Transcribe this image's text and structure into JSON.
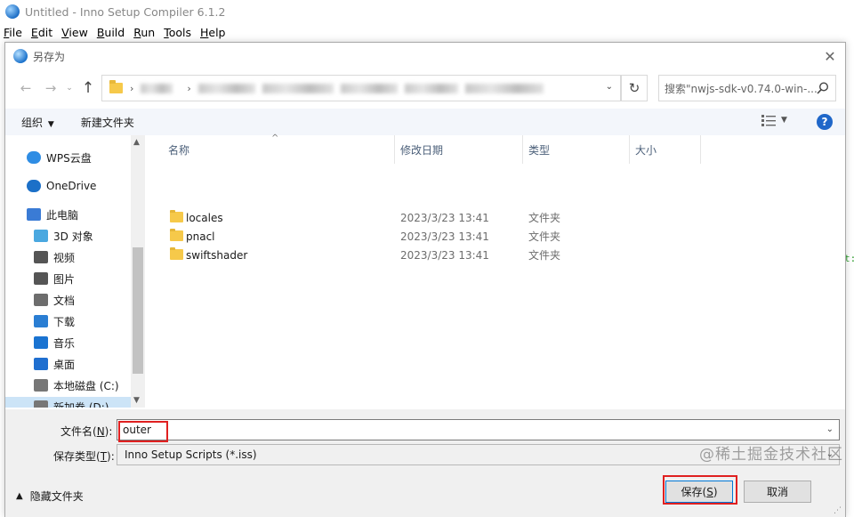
{
  "app": {
    "title": "Untitled - Inno Setup Compiler 6.1.2",
    "menu": [
      {
        "label": "File",
        "ul": "F",
        "rest": "ile"
      },
      {
        "label": "Edit",
        "ul": "E",
        "rest": "dit"
      },
      {
        "label": "View",
        "ul": "V",
        "rest": "iew"
      },
      {
        "label": "Build",
        "ul": "B",
        "rest": "uild"
      },
      {
        "label": "Run",
        "ul": "R",
        "rest": "un"
      },
      {
        "label": "Tools",
        "ul": "T",
        "rest": "ools"
      },
      {
        "label": "Help",
        "ul": "H",
        "rest": "elp"
      }
    ],
    "editor_glyph": "t:"
  },
  "dialog": {
    "title": "另存为",
    "close_glyph": "✕",
    "address": {
      "sep": "›",
      "chevron": "⌄",
      "refresh_glyph": "↻"
    },
    "search": {
      "placeholder": "搜索\"nwjs-sdk-v0.74.0-win-..."
    },
    "toolbar": {
      "organize": "组织",
      "new_folder": "新建文件夹",
      "help": "?"
    },
    "nav": {
      "items": [
        {
          "label": "WPS云盘",
          "icon": "cloud-icon",
          "color": "#2f8de4"
        },
        {
          "label": "OneDrive",
          "icon": "onedrive-icon",
          "color": "#1c70c8"
        },
        {
          "label": "此电脑",
          "icon": "computer-icon",
          "color": "#3a7bd5"
        },
        {
          "label": "3D 对象",
          "icon": "cube-3d-icon",
          "color": "#4aa8e0"
        },
        {
          "label": "视频",
          "icon": "video-icon",
          "color": "#555555"
        },
        {
          "label": "图片",
          "icon": "picture-icon",
          "color": "#555555"
        },
        {
          "label": "文档",
          "icon": "document-icon",
          "color": "#6d6d6d"
        },
        {
          "label": "下载",
          "icon": "download-icon",
          "color": "#2a7ed3"
        },
        {
          "label": "音乐",
          "icon": "music-icon",
          "color": "#1a73d1"
        },
        {
          "label": "桌面",
          "icon": "desktop-icon",
          "color": "#1f6fd0"
        },
        {
          "label": "本地磁盘 (C:)",
          "icon": "drive-c-icon",
          "color": "#777777"
        },
        {
          "label": "新加卷 (D:)",
          "icon": "drive-d-icon",
          "color": "#777777"
        }
      ],
      "selected_index": 11
    },
    "columns": {
      "name": "名称",
      "date": "修改日期",
      "type": "类型",
      "size": "大小"
    },
    "files": [
      {
        "name": "locales",
        "date": "2023/3/23 13:41",
        "type": "文件夹"
      },
      {
        "name": "pnacl",
        "date": "2023/3/23 13:41",
        "type": "文件夹"
      },
      {
        "name": "swiftshader",
        "date": "2023/3/23 13:41",
        "type": "文件夹"
      }
    ],
    "filename": {
      "label": "文件名(",
      "label_ul": "N",
      "label_end": "):",
      "value": "outer"
    },
    "filetype": {
      "label": "保存类型(",
      "label_ul": "T",
      "label_end": "):",
      "value": "Inno Setup Scripts (*.iss)"
    },
    "hide_folders": "隐藏文件夹",
    "save": {
      "label": "保存(",
      "ul": "S",
      "end": ")"
    },
    "cancel": "取消",
    "watermark": "@稀土掘金技术社区"
  }
}
